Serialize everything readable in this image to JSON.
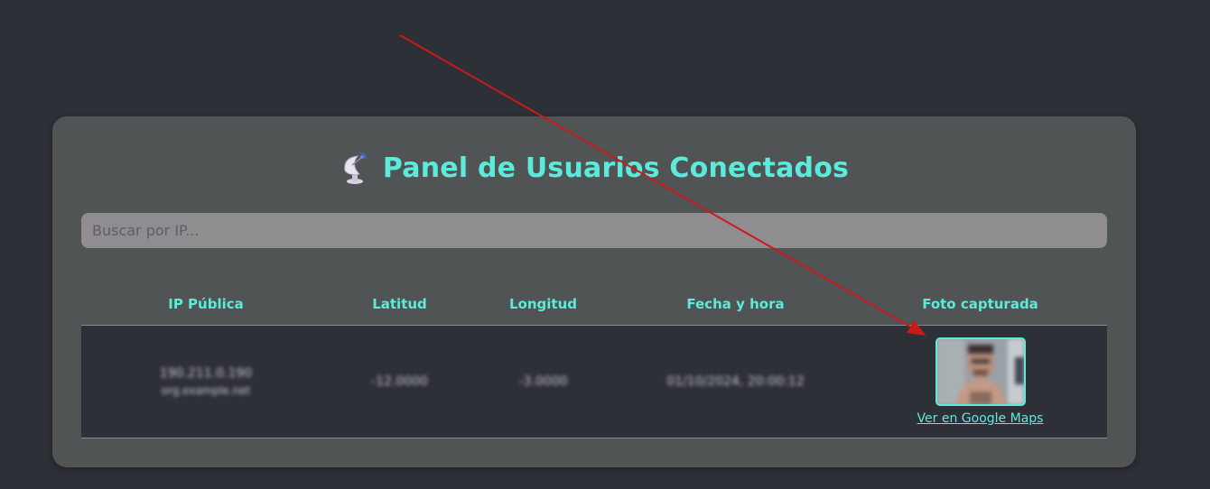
{
  "panel": {
    "title": "Panel de Usuarios Conectados",
    "title_icon": "satellite-dish-icon"
  },
  "search": {
    "placeholder": "Buscar por IP...",
    "value": ""
  },
  "table": {
    "headers": [
      "IP Pública",
      "Latitud",
      "Longitud",
      "Fecha y hora",
      "Foto capturada"
    ],
    "rows": [
      {
        "ip": "190.211.0.190",
        "ip_sub": "org.example.net",
        "lat": "-12.0000",
        "lon": "-3.0000",
        "datetime": "01/10/2024, 20:00:12",
        "photo_icon": "captured-photo",
        "maps_link": "Ver en Google Maps"
      }
    ]
  },
  "colors": {
    "accent": "#5eeadb",
    "page_bg": "#2e3038",
    "panel_bg": "#505454",
    "annotation_arrow": "#cc1a1a"
  }
}
